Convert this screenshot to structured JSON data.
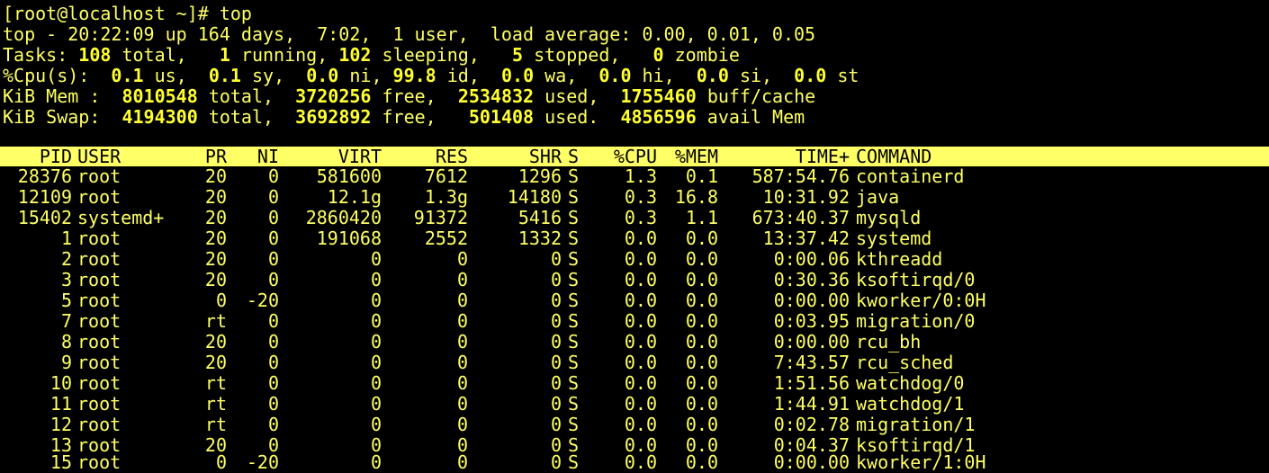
{
  "terminal": {
    "prompt": "[root@localhost ~]# top",
    "top_line": "top - 20:22:09 up 164 days,  7:02,  1 user,  load average: 0.00, 0.01, 0.05",
    "tasks": {
      "label": "Tasks:",
      "total": "108",
      "total_lbl": "total,",
      "running": "1",
      "running_lbl": "running,",
      "sleeping": "102",
      "sleeping_lbl": "sleeping,",
      "stopped": "5",
      "stopped_lbl": "stopped,",
      "zombie": "0",
      "zombie_lbl": "zombie"
    },
    "cpu": {
      "label": "%Cpu(s):",
      "us": "0.1",
      "us_lbl": "us,",
      "sy": "0.1",
      "sy_lbl": "sy,",
      "ni": "0.0",
      "ni_lbl": "ni,",
      "id": "99.8",
      "id_lbl": "id,",
      "wa": "0.0",
      "wa_lbl": "wa,",
      "hi": "0.0",
      "hi_lbl": "hi,",
      "si": "0.0",
      "si_lbl": "si,",
      "st": "0.0",
      "st_lbl": "st"
    },
    "mem": {
      "label": "KiB Mem :",
      "total": "8010548",
      "total_lbl": "total,",
      "free": "3720256",
      "free_lbl": "free,",
      "used": "2534832",
      "used_lbl": "used,",
      "buff": "1755460",
      "buff_lbl": "buff/cache"
    },
    "swap": {
      "label": "KiB Swap:",
      "total": "4194300",
      "total_lbl": "total,",
      "free": "3692892",
      "free_lbl": "free,",
      "used": "501408",
      "used_lbl": "used.",
      "avail": "4856596",
      "avail_lbl": "avail Mem"
    },
    "columns": {
      "pid": "PID",
      "user": "USER",
      "pr": "PR",
      "ni": "NI",
      "virt": "VIRT",
      "res": "RES",
      "shr": "SHR",
      "s": "S",
      "cpu": "%CPU",
      "mem": "%MEM",
      "time": "TIME+",
      "command": "COMMAND"
    },
    "processes": [
      {
        "pid": "28376",
        "user": "root",
        "pr": "20",
        "ni": "0",
        "virt": "581600",
        "res": "7612",
        "shr": "1296",
        "s": "S",
        "cpu": "1.3",
        "mem": "0.1",
        "time": "587:54.76",
        "command": "containerd"
      },
      {
        "pid": "12109",
        "user": "root",
        "pr": "20",
        "ni": "0",
        "virt": "12.1g",
        "res": "1.3g",
        "shr": "14180",
        "s": "S",
        "cpu": "0.3",
        "mem": "16.8",
        "time": "10:31.92",
        "command": "java"
      },
      {
        "pid": "15402",
        "user": "systemd+",
        "pr": "20",
        "ni": "0",
        "virt": "2860420",
        "res": "91372",
        "shr": "5416",
        "s": "S",
        "cpu": "0.3",
        "mem": "1.1",
        "time": "673:40.37",
        "command": "mysqld"
      },
      {
        "pid": "1",
        "user": "root",
        "pr": "20",
        "ni": "0",
        "virt": "191068",
        "res": "2552",
        "shr": "1332",
        "s": "S",
        "cpu": "0.0",
        "mem": "0.0",
        "time": "13:37.42",
        "command": "systemd"
      },
      {
        "pid": "2",
        "user": "root",
        "pr": "20",
        "ni": "0",
        "virt": "0",
        "res": "0",
        "shr": "0",
        "s": "S",
        "cpu": "0.0",
        "mem": "0.0",
        "time": "0:00.06",
        "command": "kthreadd"
      },
      {
        "pid": "3",
        "user": "root",
        "pr": "20",
        "ni": "0",
        "virt": "0",
        "res": "0",
        "shr": "0",
        "s": "S",
        "cpu": "0.0",
        "mem": "0.0",
        "time": "0:30.36",
        "command": "ksoftirqd/0"
      },
      {
        "pid": "5",
        "user": "root",
        "pr": "0",
        "ni": "-20",
        "virt": "0",
        "res": "0",
        "shr": "0",
        "s": "S",
        "cpu": "0.0",
        "mem": "0.0",
        "time": "0:00.00",
        "command": "kworker/0:0H"
      },
      {
        "pid": "7",
        "user": "root",
        "pr": "rt",
        "ni": "0",
        "virt": "0",
        "res": "0",
        "shr": "0",
        "s": "S",
        "cpu": "0.0",
        "mem": "0.0",
        "time": "0:03.95",
        "command": "migration/0"
      },
      {
        "pid": "8",
        "user": "root",
        "pr": "20",
        "ni": "0",
        "virt": "0",
        "res": "0",
        "shr": "0",
        "s": "S",
        "cpu": "0.0",
        "mem": "0.0",
        "time": "0:00.00",
        "command": "rcu_bh"
      },
      {
        "pid": "9",
        "user": "root",
        "pr": "20",
        "ni": "0",
        "virt": "0",
        "res": "0",
        "shr": "0",
        "s": "S",
        "cpu": "0.0",
        "mem": "0.0",
        "time": "7:43.57",
        "command": "rcu_sched"
      },
      {
        "pid": "10",
        "user": "root",
        "pr": "rt",
        "ni": "0",
        "virt": "0",
        "res": "0",
        "shr": "0",
        "s": "S",
        "cpu": "0.0",
        "mem": "0.0",
        "time": "1:51.56",
        "command": "watchdog/0"
      },
      {
        "pid": "11",
        "user": "root",
        "pr": "rt",
        "ni": "0",
        "virt": "0",
        "res": "0",
        "shr": "0",
        "s": "S",
        "cpu": "0.0",
        "mem": "0.0",
        "time": "1:44.91",
        "command": "watchdog/1"
      },
      {
        "pid": "12",
        "user": "root",
        "pr": "rt",
        "ni": "0",
        "virt": "0",
        "res": "0",
        "shr": "0",
        "s": "S",
        "cpu": "0.0",
        "mem": "0.0",
        "time": "0:02.78",
        "command": "migration/1"
      },
      {
        "pid": "13",
        "user": "root",
        "pr": "20",
        "ni": "0",
        "virt": "0",
        "res": "0",
        "shr": "0",
        "s": "S",
        "cpu": "0.0",
        "mem": "0.0",
        "time": "0:04.37",
        "command": "ksoftirqd/1"
      },
      {
        "pid": "15",
        "user": "root",
        "pr": "0",
        "ni": "-20",
        "virt": "0",
        "res": "0",
        "shr": "0",
        "s": "S",
        "cpu": "0.0",
        "mem": "0.0",
        "time": "0:00.00",
        "command": "kworker/1:0H"
      }
    ],
    "colors": {
      "background": "#000000",
      "text": "#ffff66",
      "header_bar": "#ffff66",
      "header_text": "#000000"
    }
  }
}
